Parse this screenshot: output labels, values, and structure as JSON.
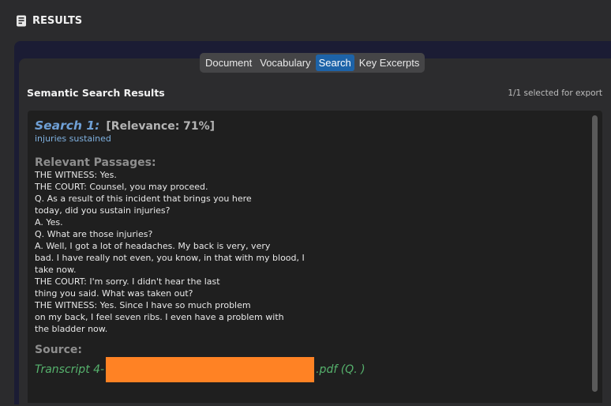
{
  "header": {
    "title": "RESULTS",
    "icon": "document-list-icon"
  },
  "tabs": [
    {
      "label": "Document",
      "active": false
    },
    {
      "label": "Vocabulary",
      "active": false
    },
    {
      "label": "Search",
      "active": true
    },
    {
      "label": "Key Excerpts",
      "active": false
    }
  ],
  "section": {
    "title": "Semantic Search Results",
    "export_status": "1/1 selected for export"
  },
  "result": {
    "search_label": "Search 1:",
    "relevance": "[Relevance: 71%]",
    "query": "injuries sustained",
    "passages_label": "Relevant Passages:",
    "passages": [
      "THE WITNESS: Yes.",
      "THE COURT: Counsel, you may proceed.",
      "Q. As a result of this incident that brings you here",
      "today, did you sustain injuries?",
      "A. Yes.",
      "Q. What are those injuries?",
      "A. Well, I got a lot of headaches. My back is very, very",
      "bad. I have really not even, you know, in that with my blood, I",
      "take now.",
      "THE COURT: I'm sorry. I didn't hear the last",
      "thing you said. What was taken out?",
      "THE WITNESS: Yes. Since I have so much problem",
      "on my back, I feel seven ribs. I even have a problem with",
      "the bladder now."
    ],
    "source_label": "Source:",
    "source_prefix": "Transcript 4-",
    "source_suffix": ".pdf (Q. )"
  },
  "colors": {
    "accent": "#1d63a8",
    "search_label": "#6fa0d6",
    "source": "#56b26d",
    "redaction": "#ff8224"
  }
}
